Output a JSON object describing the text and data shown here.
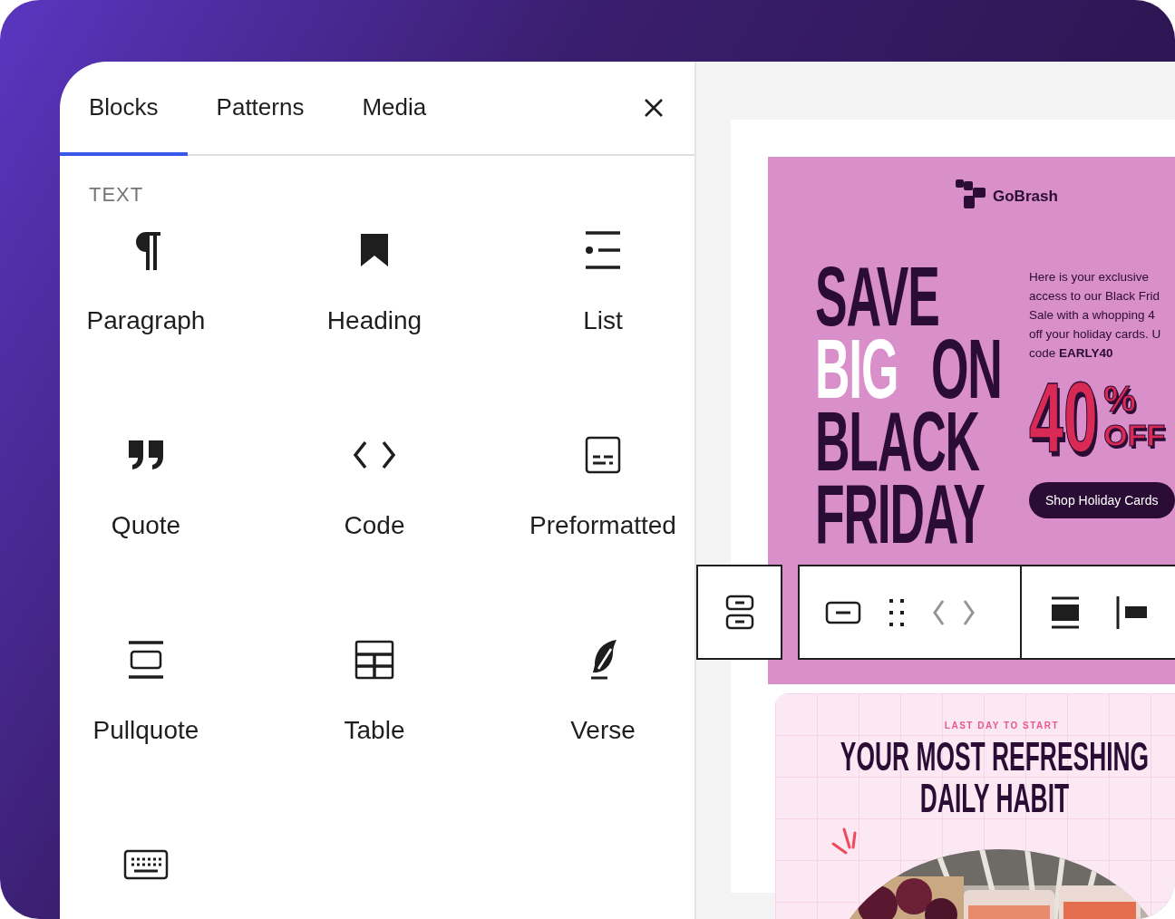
{
  "panel": {
    "tabs": [
      {
        "label": "Blocks",
        "selected": true
      },
      {
        "label": "Patterns",
        "selected": false
      },
      {
        "label": "Media",
        "selected": false
      }
    ],
    "section": "TEXT",
    "blocks": [
      {
        "kind": "paragraph",
        "label": "Paragraph"
      },
      {
        "kind": "heading",
        "label": "Heading"
      },
      {
        "kind": "list",
        "label": "List"
      },
      {
        "kind": "quote",
        "label": "Quote"
      },
      {
        "kind": "code",
        "label": "Code"
      },
      {
        "kind": "preformatted",
        "label": "Preformatted"
      },
      {
        "kind": "pullquote",
        "label": "Pullquote"
      },
      {
        "kind": "table",
        "label": "Table"
      },
      {
        "kind": "verse",
        "label": "Verse"
      },
      {
        "kind": "keyboard"
      }
    ]
  },
  "canvas": {
    "promo": {
      "logo": "GoBrash",
      "headline": [
        [
          {
            "text": "SAVE",
            "highlight": false
          }
        ],
        [
          {
            "text": "BIG",
            "highlight": true
          },
          {
            "text": "ON",
            "highlight": false
          }
        ],
        [
          {
            "text": "BLACK",
            "highlight": false
          }
        ],
        [
          {
            "text": "FRIDAY",
            "highlight": false
          }
        ]
      ],
      "body": "Here is your exclusive\naccess to our Black Frid\nSale with a whopping 4\noff your holiday cards. U\ncode **EARLY40**",
      "amount": "40",
      "unit": "%",
      "suffix": "OFF",
      "button": "Shop Holiday Cards"
    },
    "toolbar": [
      [
        {
          "kind": "stack"
        }
      ],
      [
        {
          "kind": "block"
        },
        {
          "kind": "drag"
        },
        {
          "kind": "move"
        }
      ],
      [
        {
          "kind": "align-wide"
        },
        {
          "kind": "align-left"
        }
      ]
    ],
    "teaser": {
      "eyebrow": "LAST DAY TO START",
      "title": "YOUR MOST REFRESHING\nDAILY HABIT"
    }
  }
}
